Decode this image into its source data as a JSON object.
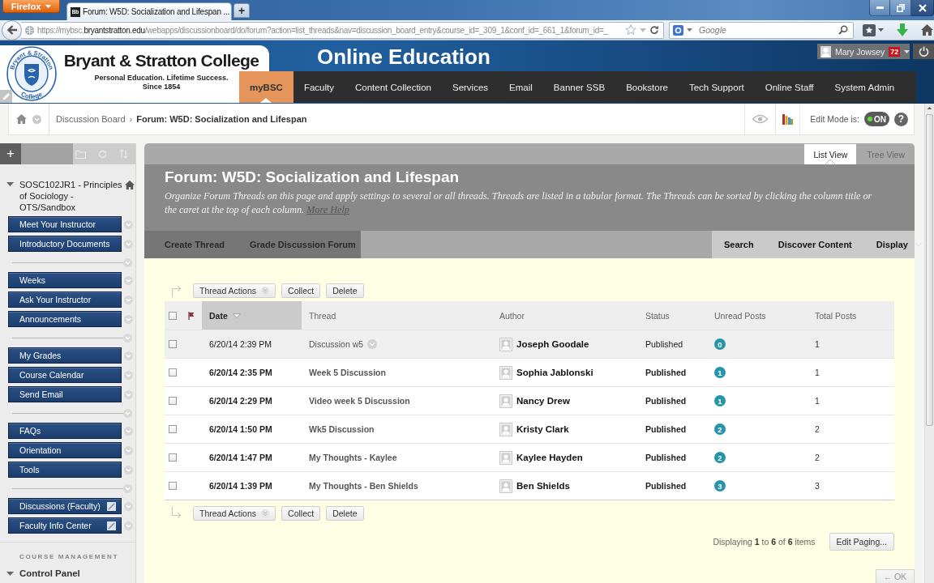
{
  "browser": {
    "menu_button": "Firefox",
    "tab": {
      "favicon": "Bb",
      "title": "Forum: W5D: Socialization and Lifespan ..."
    },
    "new_tab": "+",
    "address": {
      "scheme": "https://mybsc.",
      "domain": "bryantstratton.edu",
      "path": "/webapps/discussionboard/do/forum?action=list_threads&nav=discussion_board_entry&course_id=_309_1&conf_id=_661_1&forum_id=_"
    },
    "search": {
      "placeholder": "Google"
    }
  },
  "header": {
    "seal_top": "Bryant & Stratton",
    "seal_bottom": "College",
    "college": "Bryant & Stratton College",
    "tagline": "Personal Education. Lifetime Success.",
    "since": "Since 1854",
    "title": "Online Education",
    "user": {
      "name": "Mary Jowsey",
      "notifications": "72"
    },
    "menu": [
      {
        "label": "myBSC",
        "selected": true
      },
      {
        "label": "Faculty",
        "selected": false
      },
      {
        "label": "Content Collection",
        "selected": false
      },
      {
        "label": "Services",
        "selected": false
      },
      {
        "label": "Email",
        "selected": false
      },
      {
        "label": "Banner SSB",
        "selected": false
      },
      {
        "label": "Bookstore",
        "selected": false
      },
      {
        "label": "Tech Support",
        "selected": false
      },
      {
        "label": "Online Staff",
        "selected": false
      },
      {
        "label": "System Admin",
        "selected": false
      }
    ]
  },
  "breadcrumb": {
    "items": [
      {
        "label": "Discussion Board",
        "current": false
      },
      {
        "label": "Forum: W5D: Socialization and Lifespan",
        "current": true
      }
    ],
    "separator": "›",
    "edit_mode": {
      "label": "Edit Mode is:",
      "on": true,
      "state": "ON"
    },
    "help": "?"
  },
  "sidebar": {
    "add_button": "+",
    "course": {
      "title": "SOSC102JR1 - Principles of Sociology - OTS/Sandbox",
      "expanded": true
    },
    "groups": [
      {
        "items": [
          {
            "label": "Meet Your Instructor",
            "kind": "link"
          },
          {
            "label": "Introductory Documents",
            "kind": "link"
          }
        ]
      },
      {
        "items": [
          {
            "label": "Weeks",
            "kind": "link"
          },
          {
            "label": "Ask Your Instructor",
            "kind": "link"
          },
          {
            "label": "Announcements",
            "kind": "link"
          }
        ]
      },
      {
        "items": [
          {
            "label": "My Grades",
            "kind": "link"
          },
          {
            "label": "Course Calendar",
            "kind": "link"
          },
          {
            "label": "Send Email",
            "kind": "link"
          }
        ]
      },
      {
        "items": [
          {
            "label": "FAQs",
            "kind": "link"
          },
          {
            "label": "Orientation",
            "kind": "link"
          },
          {
            "label": "Tools",
            "kind": "link"
          }
        ]
      },
      {
        "items": [
          {
            "label": "Discussions (Faculty)",
            "kind": "tool_link"
          },
          {
            "label": "Faculty Info Center",
            "kind": "tool_link"
          }
        ]
      }
    ],
    "management": {
      "heading": "COURSE MANAGEMENT",
      "panel": "Control Panel",
      "expanded": true
    }
  },
  "forum": {
    "views": [
      {
        "label": "List View",
        "selected": true
      },
      {
        "label": "Tree View",
        "selected": false
      }
    ],
    "title": "Forum: W5D: Socialization and Lifespan",
    "description": "Organize Forum Threads on this page and apply settings to several or all threads. Threads are listed in a tabular format. The Threads can be sorted by clicking the column title or the caret at the top of each column.",
    "help_link": "More Help",
    "actions": [
      "Create Thread",
      "Grade Discussion Forum"
    ],
    "tools": [
      {
        "label": "Search",
        "kind": "link"
      },
      {
        "label": "Discover Content",
        "kind": "link"
      },
      {
        "label": "Display",
        "kind": "menu"
      }
    ]
  },
  "table": {
    "top_buttons": [
      {
        "label": "Thread Actions",
        "kind": "menu"
      },
      {
        "label": "Collect",
        "kind": "plain"
      },
      {
        "label": "Delete",
        "kind": "plain"
      }
    ],
    "select_all": {
      "checked": false
    },
    "columns": [
      {
        "label": "Date",
        "sorted": true
      },
      {
        "label": "Thread",
        "sorted": false
      },
      {
        "label": "Author",
        "sorted": false
      },
      {
        "label": "Status",
        "sorted": false
      },
      {
        "label": "Unread Posts",
        "sorted": false
      },
      {
        "label": "Total Posts",
        "sorted": false
      }
    ],
    "rows": [
      {
        "date": "6/20/14 2:39 PM",
        "thread": "Discussion w5",
        "author": "Joseph Goodale",
        "status": "Published",
        "unread": "0",
        "total": "1",
        "read": true,
        "hovered": true,
        "checked": false
      },
      {
        "date": "6/20/14 2:35 PM",
        "thread": "Week 5 Discussion",
        "author": "Sophia Jablonski",
        "status": "Published",
        "unread": "1",
        "total": "1",
        "read": false,
        "hovered": false,
        "checked": false
      },
      {
        "date": "6/20/14 2:29 PM",
        "thread": "Video week 5 Discussion",
        "author": "Nancy Drew",
        "status": "Published",
        "unread": "1",
        "total": "1",
        "read": false,
        "hovered": false,
        "checked": false
      },
      {
        "date": "6/20/14 1:50 PM",
        "thread": "Wk5 Discussion",
        "author": "Kristy Clark",
        "status": "Published",
        "unread": "2",
        "total": "2",
        "read": false,
        "hovered": false,
        "checked": false
      },
      {
        "date": "6/20/14 1:47 PM",
        "thread": "My Thoughts - Kaylee",
        "author": "Kaylee Hayden",
        "status": "Published",
        "unread": "2",
        "total": "2",
        "read": false,
        "hovered": false,
        "checked": false
      },
      {
        "date": "6/20/14 1:39 PM",
        "thread": "My Thoughts - Ben Shields",
        "author": "Ben Shields",
        "status": "Published",
        "unread": "3",
        "total": "3",
        "read": false,
        "hovered": false,
        "checked": false
      }
    ],
    "bottom_buttons": [
      {
        "label": "Thread Actions",
        "kind": "menu"
      },
      {
        "label": "Collect",
        "kind": "plain"
      },
      {
        "label": "Delete",
        "kind": "plain"
      }
    ],
    "paging": "Displaying **1** to **6** of **6** items",
    "edit_paging": "Edit Paging...",
    "ok_button": "← OK"
  }
}
